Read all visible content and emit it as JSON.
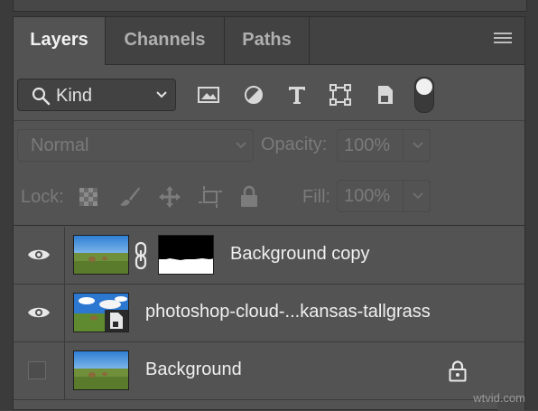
{
  "tabs": [
    {
      "label": "Layers",
      "active": true
    },
    {
      "label": "Channels",
      "active": false
    },
    {
      "label": "Paths",
      "active": false
    }
  ],
  "filter": {
    "kind_label": "Kind",
    "icons": [
      "image-filter-icon",
      "adjustment-filter-icon",
      "type-filter-icon",
      "shape-filter-icon",
      "smart-object-filter-icon",
      "filter-toggle-switch"
    ]
  },
  "blend": {
    "mode": "Normal",
    "opacity_label": "Opacity:",
    "opacity_value": "100%"
  },
  "lock": {
    "label": "Lock:",
    "fill_label": "Fill:",
    "fill_value": "100%"
  },
  "layers": [
    {
      "name": "Background copy",
      "visible": true,
      "has_mask": true,
      "smart_object": false,
      "locked": false
    },
    {
      "name": "photoshop-cloud-...kansas-tallgrass",
      "visible": true,
      "has_mask": false,
      "smart_object": true,
      "locked": false
    },
    {
      "name": "Background",
      "visible": false,
      "has_mask": false,
      "smart_object": false,
      "locked": true
    }
  ],
  "watermark": "wtvid.com",
  "colors": {
    "panel": "#535353",
    "tabbar": "#424242",
    "text": "#f0f0f0",
    "dim_text": "#7a7a7a"
  }
}
